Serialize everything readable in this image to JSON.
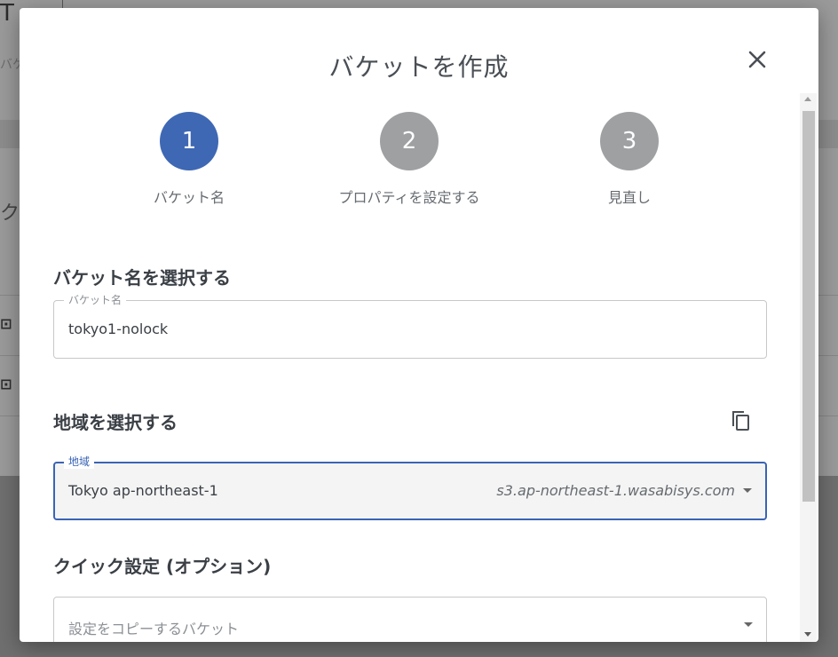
{
  "background": {
    "top_glyph": "T",
    "side_text": "バケ",
    "side_big": "ク"
  },
  "dialog": {
    "title": "バケットを作成",
    "close_icon": "close-icon"
  },
  "stepper": {
    "steps": [
      {
        "number": "1",
        "label": "バケット名",
        "active": true
      },
      {
        "number": "2",
        "label": "プロパティを設定する",
        "active": false
      },
      {
        "number": "3",
        "label": "見直し",
        "active": false
      }
    ],
    "colors": {
      "active": "#3e68b4",
      "inactive": "#9ea0a2"
    }
  },
  "bucket_section": {
    "title": "バケット名を選択する",
    "field_label": "バケット名",
    "field_value": "tokyo1-nolock"
  },
  "region_section": {
    "title": "地域を選択する",
    "copy_icon": "copy-icon",
    "field_label": "地域",
    "field_value": "Tokyo ap-northeast-1",
    "endpoint": "s3.ap-northeast-1.wasabisys.com"
  },
  "quick_section": {
    "title": "クイック設定 (オプション)",
    "placeholder": "設定をコピーするバケット"
  }
}
